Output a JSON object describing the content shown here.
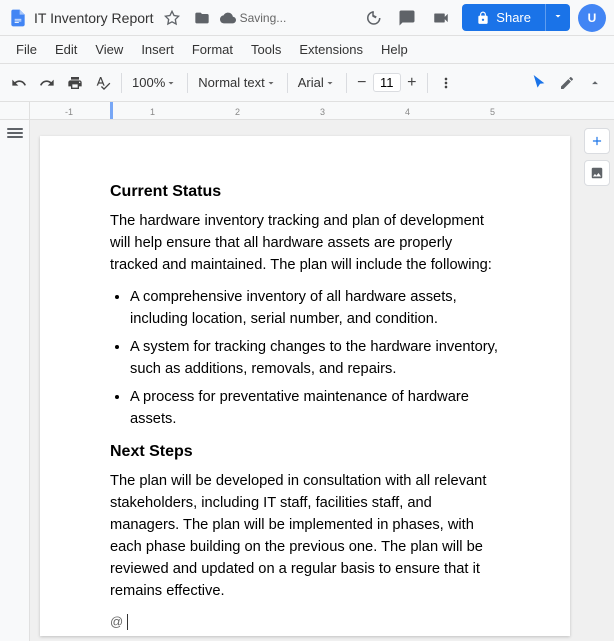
{
  "titleBar": {
    "title": "IT Inventory Report",
    "savingStatus": "Saving...",
    "shareLabel": "Share"
  },
  "menuBar": {
    "items": [
      "File",
      "Edit",
      "View",
      "Insert",
      "Format",
      "Tools",
      "Extensions",
      "Help"
    ]
  },
  "toolbar": {
    "zoomLevel": "100%",
    "textStyle": "Normal text",
    "fontFamily": "Arial",
    "fontSize": "11"
  },
  "ruler": {
    "marks": [
      "-1",
      "1",
      "2",
      "3",
      "4",
      "5"
    ]
  },
  "document": {
    "sections": [
      {
        "type": "heading",
        "text": "Current Status"
      },
      {
        "type": "paragraph",
        "text": "The hardware inventory tracking and plan of development will help ensure that all hardware assets are properly tracked and maintained. The plan will include the following:"
      },
      {
        "type": "list",
        "items": [
          "A comprehensive inventory of all hardware assets, including location, serial number, and condition.",
          "A system for tracking changes to the hardware inventory, such as additions, removals, and repairs.",
          "A process for preventative maintenance of hardware assets."
        ]
      },
      {
        "type": "heading",
        "text": "Next Steps"
      },
      {
        "type": "paragraph",
        "text": "The plan will be developed in consultation with all relevant stakeholders, including IT staff, facilities staff, and managers. The plan will be implemented in phases, with each phase building on the previous one. The plan will be reviewed and updated on a regular basis to ensure that it remains effective."
      }
    ]
  },
  "rightPanel": {
    "addBtn": "+",
    "imageBtn": "🖼"
  }
}
